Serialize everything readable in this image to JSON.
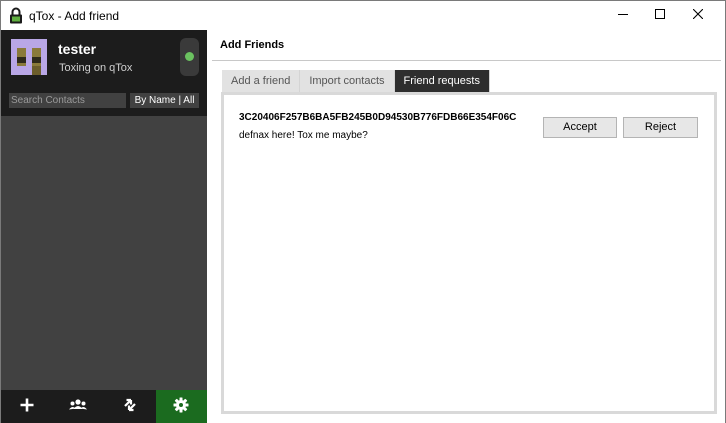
{
  "window": {
    "title": "qTox - Add friend",
    "icon": "lock-icon",
    "controls": [
      "minimize-icon",
      "maximize-icon",
      "close-icon"
    ]
  },
  "profile": {
    "name": "tester",
    "status_message": "Toxing on qTox",
    "status_color": "#6bc260"
  },
  "search": {
    "placeholder": "Search Contacts",
    "sort_label": "By Name | All"
  },
  "bottom_bar": {
    "buttons": [
      {
        "icon": "add-friend-icon",
        "active": false
      },
      {
        "icon": "group-chat-icon",
        "active": false
      },
      {
        "icon": "file-transfer-icon",
        "active": false
      },
      {
        "icon": "settings-gear-icon",
        "active": true
      }
    ],
    "active_color": "#1b6b1f"
  },
  "main": {
    "title": "Add Friends",
    "tabs": [
      {
        "label": "Add a friend",
        "active": false
      },
      {
        "label": "Import contacts",
        "active": false
      },
      {
        "label": "Friend requests",
        "active": true
      }
    ],
    "request": {
      "tox_id": "3C20406F257B6BA5FB245B0D94530B776FDB66E354F06C",
      "message": "defnax here! Tox me maybe?",
      "accept_label": "Accept",
      "reject_label": "Reject"
    }
  }
}
